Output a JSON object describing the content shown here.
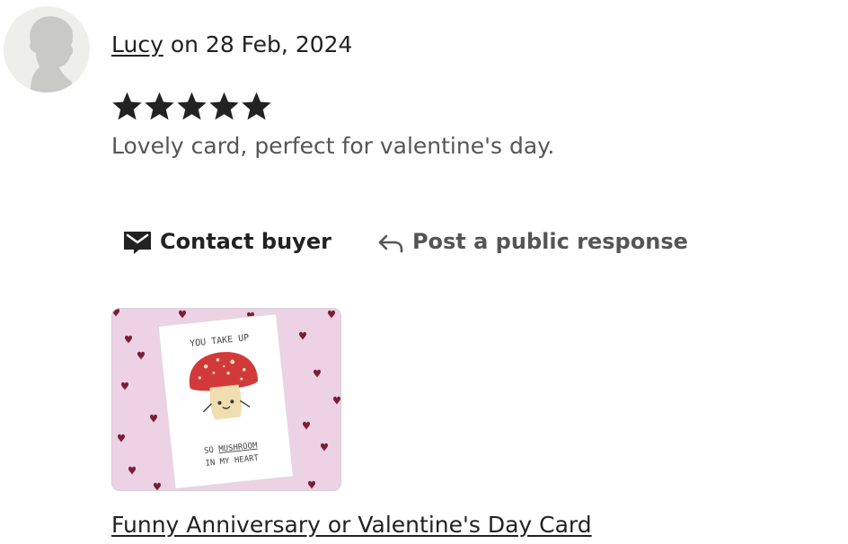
{
  "review": {
    "author": "Lucy",
    "date_text": " on 28 Feb, 2024",
    "rating": 5,
    "max_rating": 5,
    "text": "Lovely card, perfect for valentine's day."
  },
  "actions": {
    "contact_label": "Contact buyer",
    "respond_label": "Post a public response"
  },
  "product": {
    "link_label": "Funny Anniversary or Valentine's Day Card",
    "card_line1": "YOU TAKE UP",
    "card_line2_pre": "SO ",
    "card_line2_word": "MUSHROOM",
    "card_line3": "IN MY HEART"
  },
  "colors": {
    "star": "#222222",
    "background_pink": "#ecd2e4",
    "mushroom_cap": "#d23a3a",
    "heart": "#7a1d35"
  },
  "icons": {
    "avatar": "default-avatar-icon",
    "star": "star-icon",
    "contact": "envelope-icon",
    "respond": "reply-arrow-icon"
  }
}
